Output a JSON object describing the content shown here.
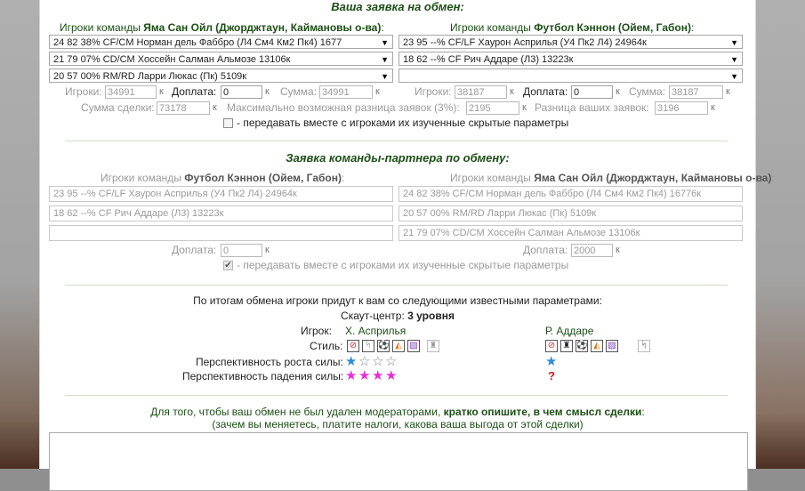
{
  "request": {
    "title": "Ваша заявка на обмен:",
    "left_header": {
      "prefix": "Игроки команды ",
      "team": "Яма Сан Ойл (Джорджтаун, Каймановы о-ва)",
      "suffix": ":"
    },
    "right_header": {
      "prefix": "Игроки команды ",
      "team": "Футбол Кэннон (Ойем, Габон)",
      "suffix": ":"
    },
    "left_players": [
      "24 82 38% CF/CM Норман дель Фаббро (Л4 См4 Км2 Пк4) 1677",
      "21 79 07% CD/CM Хоссейн Салман Альмозе 13106к",
      "20 57 00% RM/RD Ларри Люкас (Пк) 5109к"
    ],
    "right_players": [
      "23 95 --% CF/LF Хаурон Асприлья (У4 Пк2 Л4) 24964к",
      "18 62 --% CF Рич Аддаре (Л3) 13223к",
      ""
    ],
    "left_totals": {
      "players_label": "Игроки:",
      "players_value": "34991",
      "extra_label": "Доплата:",
      "extra_value": "0",
      "sum_label": "Сумма:",
      "sum_value": "34991",
      "unit": "к"
    },
    "right_totals": {
      "players_label": "Игроки:",
      "players_value": "38187",
      "extra_label": "Доплата:",
      "extra_value": "0",
      "sum_label": "Сумма:",
      "sum_value": "38187",
      "unit": "к"
    },
    "deal_sum_label": "Сумма сделки:",
    "deal_sum_value": "73178",
    "max_diff_label": "Максимально возможная разница заявок (3%):",
    "max_diff_value": "2195",
    "your_diff_label": "Разница ваших заявок:",
    "your_diff_value": "3196",
    "unit": "к",
    "hidden_params_label": "- передавать вместе с игроками их изученные скрытые параметры"
  },
  "partner": {
    "title": "Заявка команды-партнера по обмену:",
    "left_header": {
      "prefix": "Игроки команды ",
      "team": "Футбол Кэннон (Ойем, Габон)",
      "suffix": ":"
    },
    "right_header": {
      "prefix": "Игроки команды ",
      "team": "Яма Сан Ойл (Джорджтаун, Каймановы о-ва)",
      "suffix": ":"
    },
    "left_players": [
      "23 95 --% CF/LF Хаурон Асприлья (У4 Пк2 Л4) 24964к",
      "18 62 --% CF Рич Аддаре (Л3) 13223к",
      ""
    ],
    "right_players": [
      "24 82 38% CF/CM Норман дель Фаббро (Л4 См4 Км2 Пк4) 16776к",
      "20 57 00% RM/RD Ларри Люкас (Пк) 5109к",
      "21 79 07% CD/CM Хоссейн Салман Альмозе 13106к"
    ],
    "left_extra_label": "Доплата:",
    "left_extra_value": "0",
    "right_extra_label": "Доплата:",
    "right_extra_value": "2000",
    "unit": "к",
    "hidden_params_label": "- передавать вместе с игроками их изученные скрытые параметры"
  },
  "result": {
    "intro": "По итогам обмена игроки придут к вам со следующими известными параметрами:",
    "scout_label": "Скаут-центр: ",
    "scout_value": "3 уровня",
    "player_label": "Игрок:",
    "player1": "Х. Асприлья",
    "player2": "Р. Аддаре",
    "style_label": "Стиль:",
    "growth_label": "Перспективность роста силы:",
    "decline_label": "Перспективность падения силы:",
    "unknown_mark": "?"
  },
  "footer": {
    "line1_prefix": "Для того, чтобы ваш обмен не был удален модераторами, ",
    "line1_bold": "кратко опишите, в чем смысл сделки",
    "line1_suffix": ":",
    "line2": "(зачем вы меняетесь, платите налоги, какова ваша выгода от этой сделки)"
  }
}
